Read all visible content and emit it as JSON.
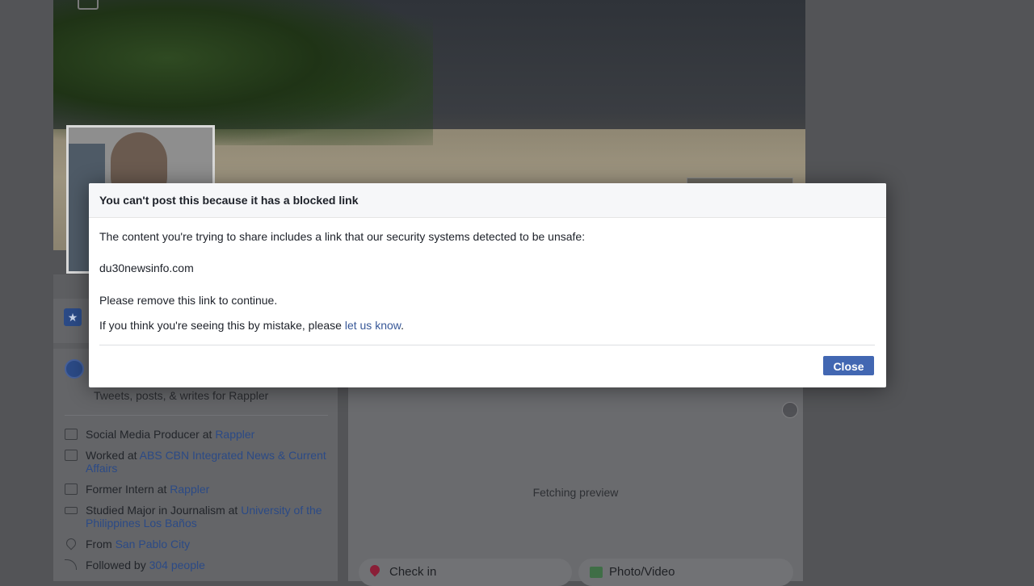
{
  "background": {
    "intro": {
      "tagline": "Tweets, posts, & writes for Rappler",
      "items": [
        {
          "icon": "briefcase-icon",
          "prefix": "Social Media Producer at ",
          "link": "Rappler"
        },
        {
          "icon": "briefcase-icon",
          "prefix": "Worked at ",
          "link": "ABS CBN Integrated News & Current Affairs"
        },
        {
          "icon": "briefcase-icon",
          "prefix": "Former Intern at ",
          "link": "Rappler"
        },
        {
          "icon": "graduation-cap-icon",
          "prefix": "Studied Major in Journalism at ",
          "link": "University of the Philippines Los Baños"
        },
        {
          "icon": "location-pin-icon",
          "prefix": "From ",
          "link": "San Pablo City"
        },
        {
          "icon": "followers-icon",
          "prefix": "Followed by ",
          "link": "304 people"
        }
      ]
    },
    "composer": {
      "preview_status": "Fetching preview",
      "check_in_label": "Check in",
      "photo_video_label": "Photo/Video"
    }
  },
  "dialog": {
    "title": "You can't post this because it has a blocked link",
    "message": "The content you're trying to share includes a link that our security systems detected to be unsafe:",
    "blocked_link": "du30newsinfo.com",
    "instruction": "Please remove this link to continue.",
    "mistake_prefix": "If you think you're seeing this by mistake, please ",
    "mistake_link": "let us know",
    "mistake_suffix": ".",
    "close_label": "Close"
  },
  "colors": {
    "primary_button": "#4267b2",
    "link": "#385898",
    "overlay": "#535457"
  }
}
